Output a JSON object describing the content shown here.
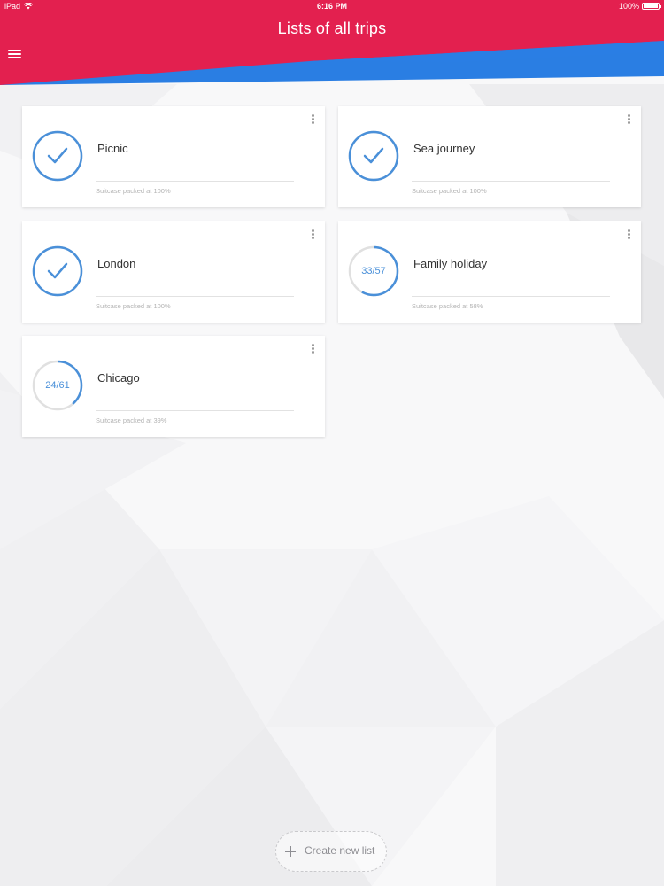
{
  "status_bar": {
    "device": "iPad",
    "time": "6:16 PM",
    "battery": "100%"
  },
  "header": {
    "title": "Lists of all trips",
    "menu_icon": "hamburger-menu-icon"
  },
  "colors": {
    "header_red": "#e3204f",
    "header_blue": "#2a7ee3",
    "accent_blue": "#4a90d9",
    "ring_track": "#e0e0e0"
  },
  "trips": [
    {
      "name": "Picnic",
      "packed": 1,
      "progress_text": "",
      "status": "Suitcase packed at 100%",
      "complete": true
    },
    {
      "name": "Sea journey",
      "packed": 1,
      "progress_text": "",
      "status": "Suitcase packed at 100%",
      "complete": true
    },
    {
      "name": "London",
      "packed": 1,
      "progress_text": "",
      "status": "Suitcase packed at 100%",
      "complete": true
    },
    {
      "name": "Family holiday",
      "packed": 0.58,
      "progress_text": "33/57",
      "status": "Suitcase packed at 58%",
      "complete": false
    },
    {
      "name": "Chicago",
      "packed": 0.39,
      "progress_text": "24/61",
      "status": "Suitcase packed at 39%",
      "complete": false
    }
  ],
  "create_button": {
    "label": "Create new list",
    "icon": "plus-icon"
  }
}
